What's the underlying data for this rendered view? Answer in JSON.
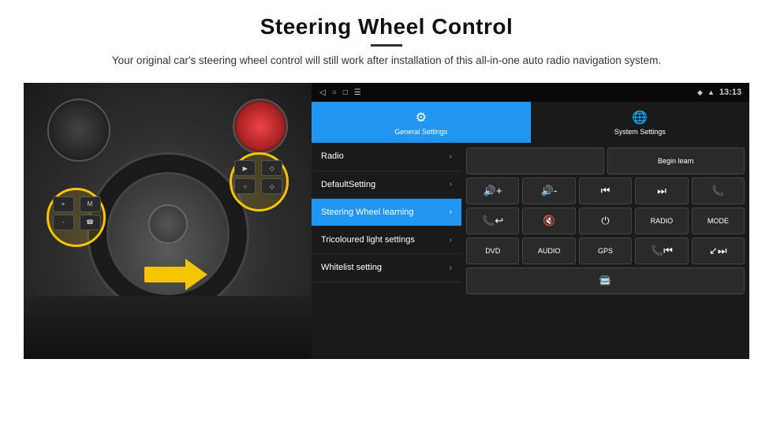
{
  "header": {
    "title": "Steering Wheel Control",
    "subtitle": "Your original car's steering wheel control will still work after installation of this all-in-one auto radio navigation system."
  },
  "status_bar": {
    "time": "13:13",
    "nav_icons": [
      "◁",
      "○",
      "□",
      "☰"
    ],
    "signal_icon": "▲▲",
    "wifi_icon": "wifi"
  },
  "tabs": [
    {
      "label": "General Settings",
      "icon": "⚙",
      "active": true
    },
    {
      "label": "System Settings",
      "icon": "🌐",
      "active": false
    }
  ],
  "menu_items": [
    {
      "label": "Radio",
      "active": false
    },
    {
      "label": "DefaultSetting",
      "active": false
    },
    {
      "label": "Steering Wheel learning",
      "active": true
    },
    {
      "label": "Tricoloured light settings",
      "active": false
    },
    {
      "label": "Whitelist setting",
      "active": false
    }
  ],
  "controls": {
    "row1": {
      "empty_box": "",
      "begin_learn": "Begin learn"
    },
    "row2": {
      "buttons": [
        "🔊+",
        "🔊-",
        "⏮",
        "⏭",
        "📞"
      ]
    },
    "row3": {
      "buttons": [
        "📞↩",
        "🔇",
        "⏻",
        "RADIO",
        "MODE"
      ]
    },
    "row4": {
      "buttons": [
        "DVD",
        "AUDIO",
        "GPS",
        "📞⏮",
        "↙⏭"
      ]
    },
    "row5": {
      "buttons": [
        "🚍"
      ]
    }
  },
  "photo_area": {
    "alt": "Steering wheel with highlighted controls"
  }
}
